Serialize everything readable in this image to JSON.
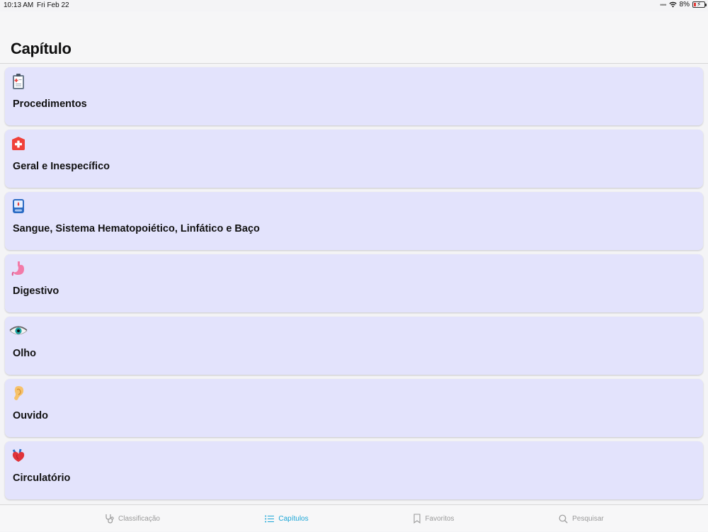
{
  "status_bar": {
    "time": "10:13 AM",
    "date": "Fri Feb 22",
    "battery": "8%"
  },
  "header": {
    "title": "Capítulo"
  },
  "chapters": [
    {
      "label": "Procedimentos",
      "icon": "clipboard-icon"
    },
    {
      "label": "Geral e Inespecífico",
      "icon": "medical-plus-icon"
    },
    {
      "label": "Sangue, Sistema Hematopoiético, Linfático e Baço",
      "icon": "blood-meter-icon"
    },
    {
      "label": "Digestivo",
      "icon": "stomach-icon"
    },
    {
      "label": "Olho",
      "icon": "eye-icon"
    },
    {
      "label": "Ouvido",
      "icon": "ear-icon"
    },
    {
      "label": "Circulatório",
      "icon": "heart-icon"
    }
  ],
  "tab_bar": {
    "tabs": [
      {
        "label": "Classificação",
        "icon": "stethoscope-icon",
        "active": false
      },
      {
        "label": "Capítulos",
        "icon": "list-icon",
        "active": true
      },
      {
        "label": "Favoritos",
        "icon": "bookmark-icon",
        "active": false
      },
      {
        "label": "Pesquisar",
        "icon": "search-icon",
        "active": false
      }
    ]
  },
  "colors": {
    "card_background": "#e3e3fc",
    "active_tab": "#1aa5d6",
    "inactive_tab": "#9a9a9a"
  }
}
